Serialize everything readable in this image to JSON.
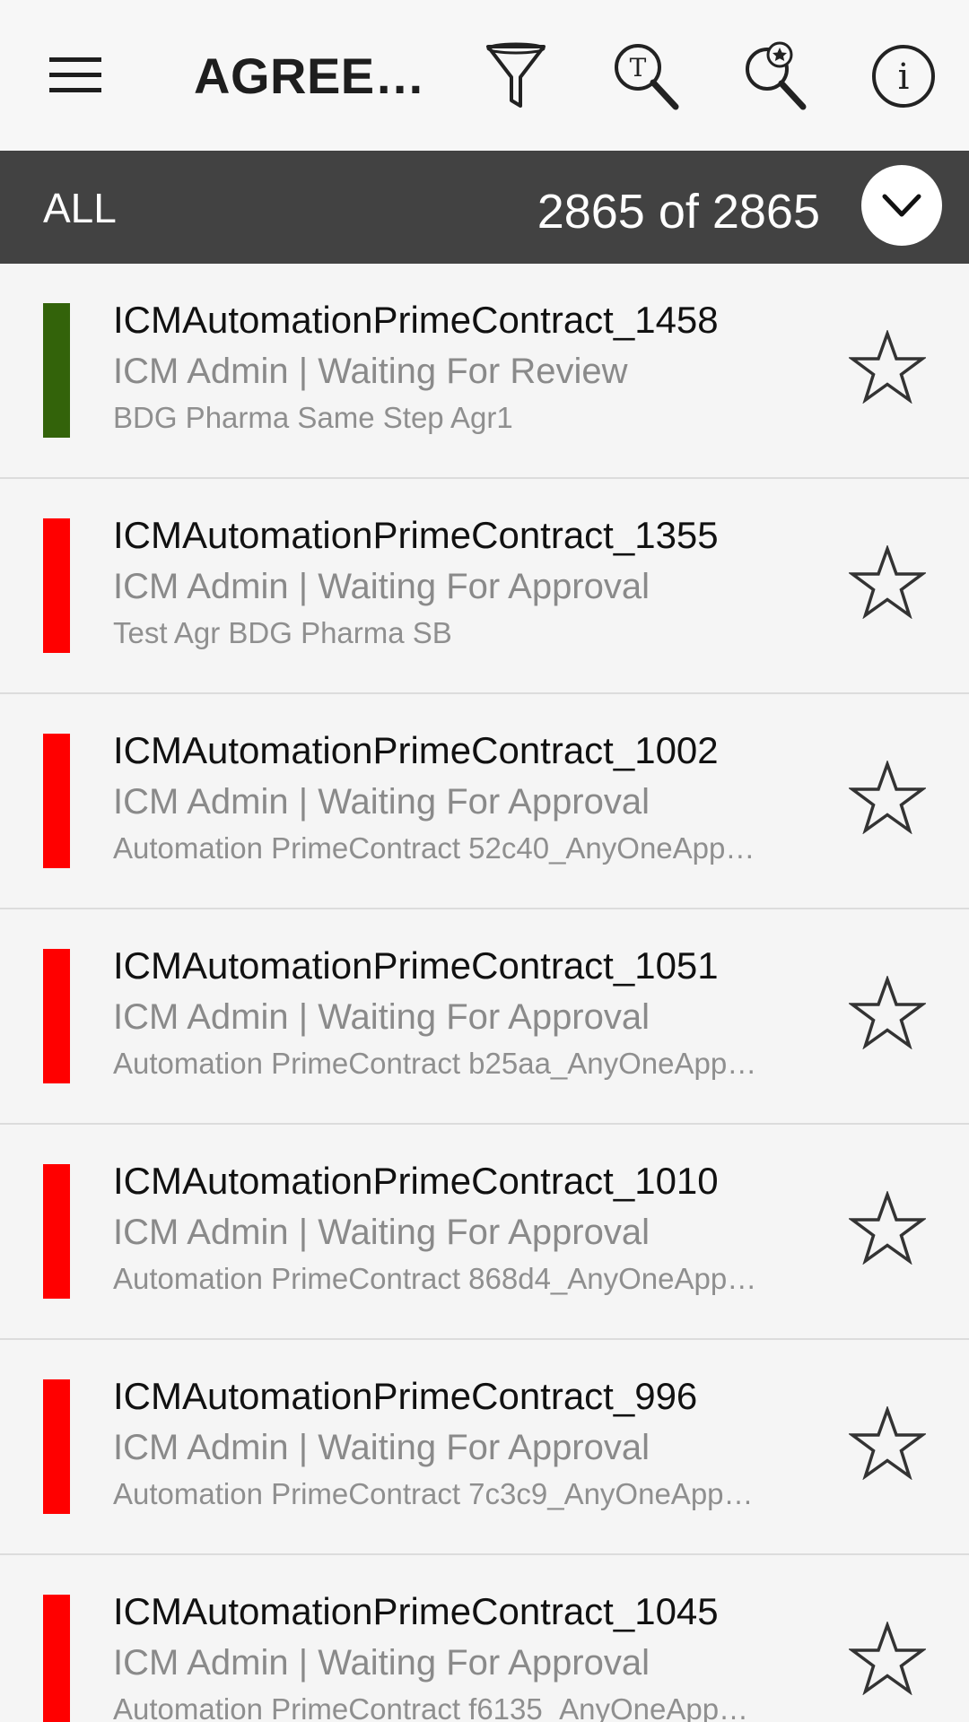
{
  "toolbar": {
    "title": "AGREE…",
    "icons": {
      "menu": "hamburger-menu-icon",
      "filter": "funnel-filter-icon",
      "text_search": "text-search-icon",
      "favorite_search": "favorite-search-icon",
      "info": "info-icon"
    }
  },
  "filter_bar": {
    "selected_view": "ALL",
    "count_text": "2865 of 2865",
    "dropdown_icon": "chevron-down-icon"
  },
  "colors": {
    "status_green": "#33630a",
    "status_red": "#ff0000",
    "filter_bar_bg": "#424242"
  },
  "agreements": [
    {
      "title": "ICMAutomationPrimeContract_1458",
      "subtitle": "ICM Admin | Waiting For Review",
      "description": "BDG Pharma Same Step Agr1",
      "status_color": "#33630a"
    },
    {
      "title": "ICMAutomationPrimeContract_1355",
      "subtitle": "ICM Admin | Waiting For Approval",
      "description": "Test Agr BDG Pharma SB",
      "status_color": "#ff0000"
    },
    {
      "title": "ICMAutomationPrimeContract_1002",
      "subtitle": "ICM Admin | Waiting For Approval",
      "description": "Automation PrimeContract 52c40_AnyOneApp…",
      "status_color": "#ff0000"
    },
    {
      "title": "ICMAutomationPrimeContract_1051",
      "subtitle": "ICM Admin | Waiting For Approval",
      "description": "Automation PrimeContract b25aa_AnyOneApp…",
      "status_color": "#ff0000"
    },
    {
      "title": "ICMAutomationPrimeContract_1010",
      "subtitle": "ICM Admin | Waiting For Approval",
      "description": "Automation PrimeContract 868d4_AnyOneApp…",
      "status_color": "#ff0000"
    },
    {
      "title": "ICMAutomationPrimeContract_996",
      "subtitle": "ICM Admin | Waiting For Approval",
      "description": "Automation PrimeContract 7c3c9_AnyOneApp…",
      "status_color": "#ff0000"
    },
    {
      "title": "ICMAutomationPrimeContract_1045",
      "subtitle": "ICM Admin | Waiting For Approval",
      "description": "Automation PrimeContract f6135_AnyOneApp…",
      "status_color": "#ff0000"
    }
  ]
}
